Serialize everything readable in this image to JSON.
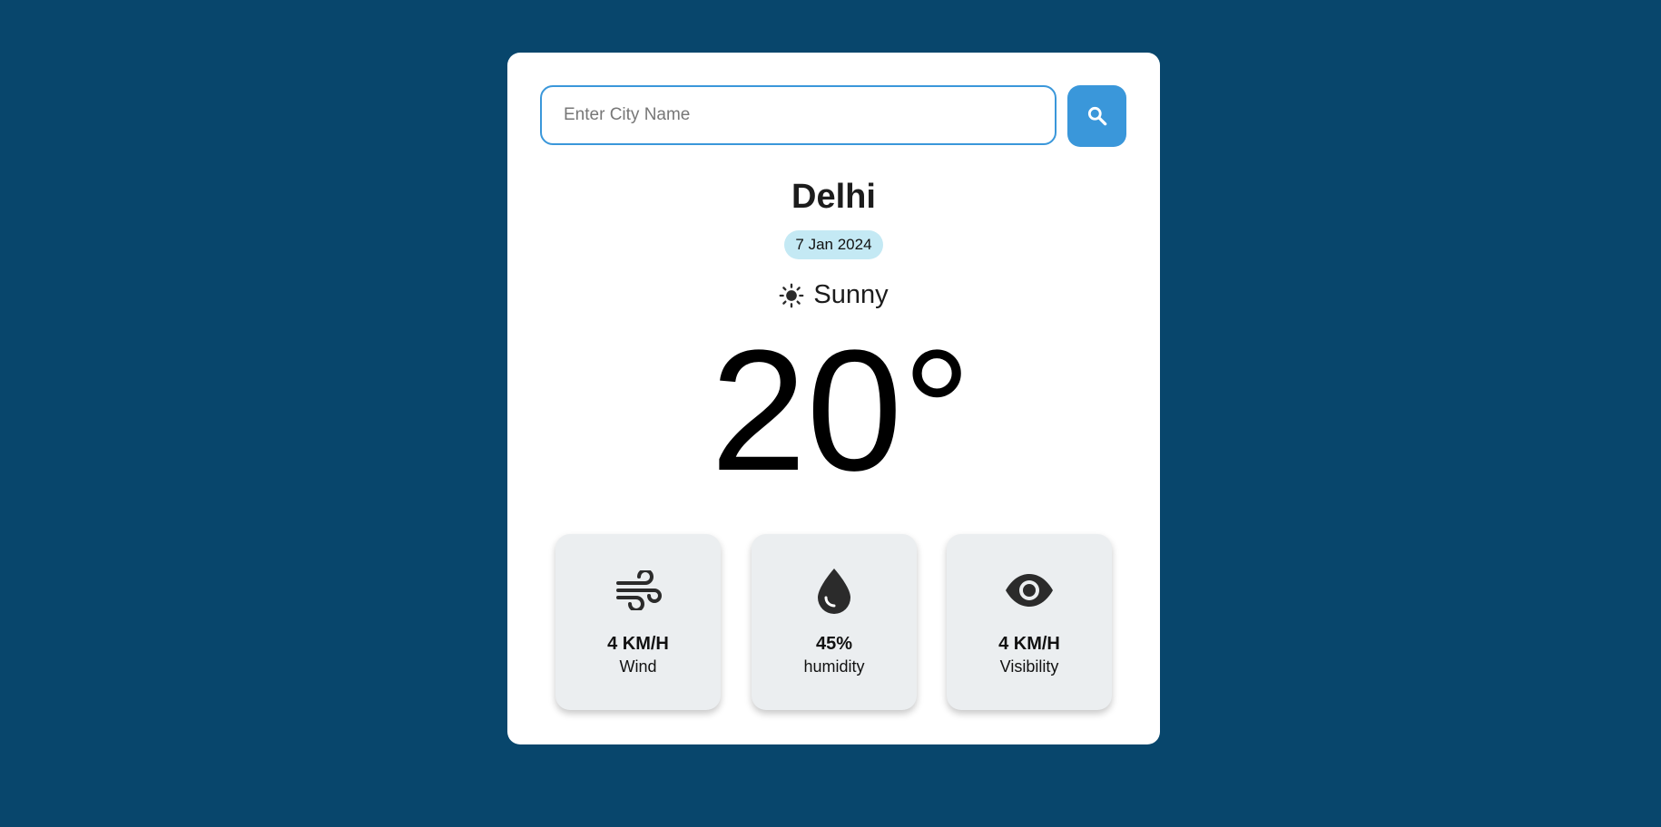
{
  "search": {
    "placeholder": "Enter City Name",
    "value": "",
    "button_icon": "search-icon"
  },
  "weather": {
    "city": "Delhi",
    "date": "7 Jan 2024",
    "condition": "Sunny",
    "condition_icon": "sun-icon",
    "temperature": "20°"
  },
  "stats": [
    {
      "icon": "wind-icon",
      "value": "4 KM/H",
      "label": "Wind"
    },
    {
      "icon": "water-drop-icon",
      "value": "45%",
      "label": "humidity"
    },
    {
      "icon": "eye-icon",
      "value": "4 KM/H",
      "label": "Visibility"
    }
  ],
  "colors": {
    "background": "#08466c",
    "card": "#ffffff",
    "accent": "#3a97da",
    "date_badge": "#c4e9f4",
    "stat_card": "#ebeef0"
  }
}
